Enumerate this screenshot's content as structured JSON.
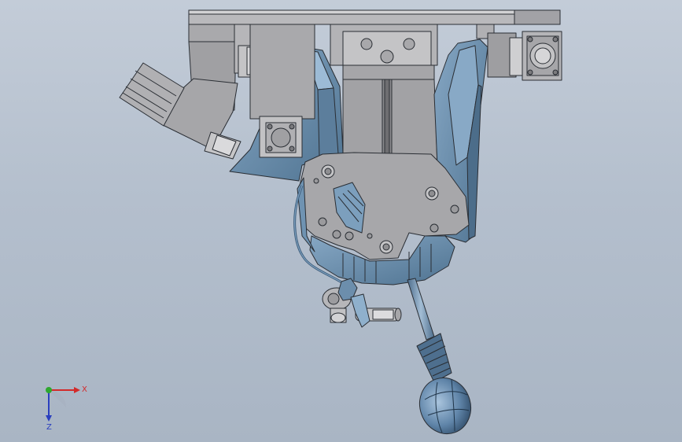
{
  "viewport": {
    "background_top": "#c3ccd8",
    "background_bottom": "#a9b5c4"
  },
  "model": {
    "description_icon": "cad-assembly-gear-shifter",
    "colors": {
      "steel": "#a7a7a9",
      "steel_dark": "#7d7e82",
      "steel_light": "#c9c9cb",
      "blue_part": "#6c8eac",
      "blue_dark": "#3f5f7c",
      "blue_light": "#8fb0cc",
      "edge": "#2a2e34",
      "knob": "#5b7fa3"
    }
  },
  "triad": {
    "x_label": "X",
    "z_label": "Z",
    "x_color": "#d32a2a",
    "y_color": "#2fa82f",
    "z_color": "#2a3fbf"
  }
}
